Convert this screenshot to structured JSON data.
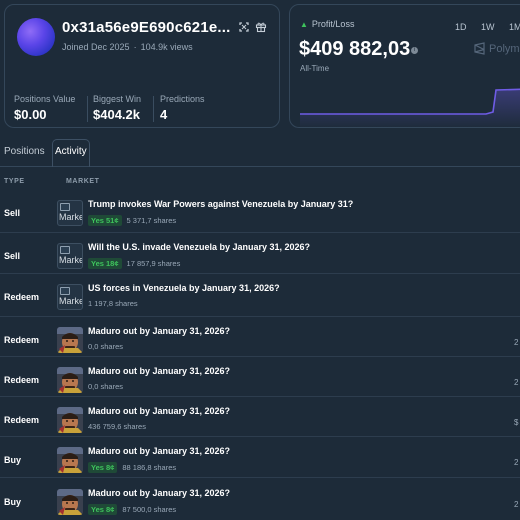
{
  "profile": {
    "address": "0x31a56e9E690c621e...",
    "joined": "Joined Dec 2025",
    "views": "104.9k views",
    "stats": [
      {
        "label": "Positions Value",
        "value": "$0.00"
      },
      {
        "label": "Biggest Win",
        "value": "$404.2k"
      },
      {
        "label": "Predictions",
        "value": "4"
      }
    ]
  },
  "pnl": {
    "label": "Profit/Loss",
    "value": "$409 882,03",
    "range": "All-Time",
    "timeframes": [
      "1D",
      "1W",
      "1M"
    ],
    "brand": "Polym",
    "trend_color": "#3ec35c",
    "line_color": "#6f5ce6"
  },
  "tabs": {
    "positions": "Positions",
    "activity": "Activity"
  },
  "columns": {
    "type": "TYPE",
    "market": "MARKET"
  },
  "activity": [
    {
      "type": "Sell",
      "title": "Trump invokes War Powers against Venezuela by January 31?",
      "badge": "Yes 51¢",
      "shares": "5 371,7 shares",
      "thumb": "broken",
      "alt": "Market",
      "edge": ""
    },
    {
      "type": "Sell",
      "title": "Will the U.S. invade Venezuela by January 31, 2026?",
      "badge": "Yes 18¢",
      "shares": "17 857,9 shares",
      "thumb": "broken",
      "alt": "Market",
      "edge": ""
    },
    {
      "type": "Redeem",
      "title": "US forces in Venezuela by January 31, 2026?",
      "badge": "",
      "shares": "1 197,8 shares",
      "thumb": "broken",
      "alt": "Market",
      "edge": ""
    },
    {
      "type": "Redeem",
      "title": "Maduro out by January 31, 2026?",
      "badge": "",
      "shares": "0,0 shares",
      "thumb": "face",
      "alt": "",
      "edge": "2"
    },
    {
      "type": "Redeem",
      "title": "Maduro out by January 31, 2026?",
      "badge": "",
      "shares": "0,0 shares",
      "thumb": "face",
      "alt": "",
      "edge": "2"
    },
    {
      "type": "Redeem",
      "title": "Maduro out by January 31, 2026?",
      "badge": "",
      "shares": "436 759,6 shares",
      "thumb": "face",
      "alt": "",
      "edge": "$"
    },
    {
      "type": "Buy",
      "title": "Maduro out by January 31, 2026?",
      "badge": "Yes 8¢",
      "shares": "88 186,8 shares",
      "thumb": "face",
      "alt": "",
      "edge": "2"
    },
    {
      "type": "Buy",
      "title": "Maduro out by January 31, 2026?",
      "badge": "Yes 8¢",
      "shares": "87 500,0 shares",
      "thumb": "face",
      "alt": "",
      "edge": "2"
    }
  ]
}
